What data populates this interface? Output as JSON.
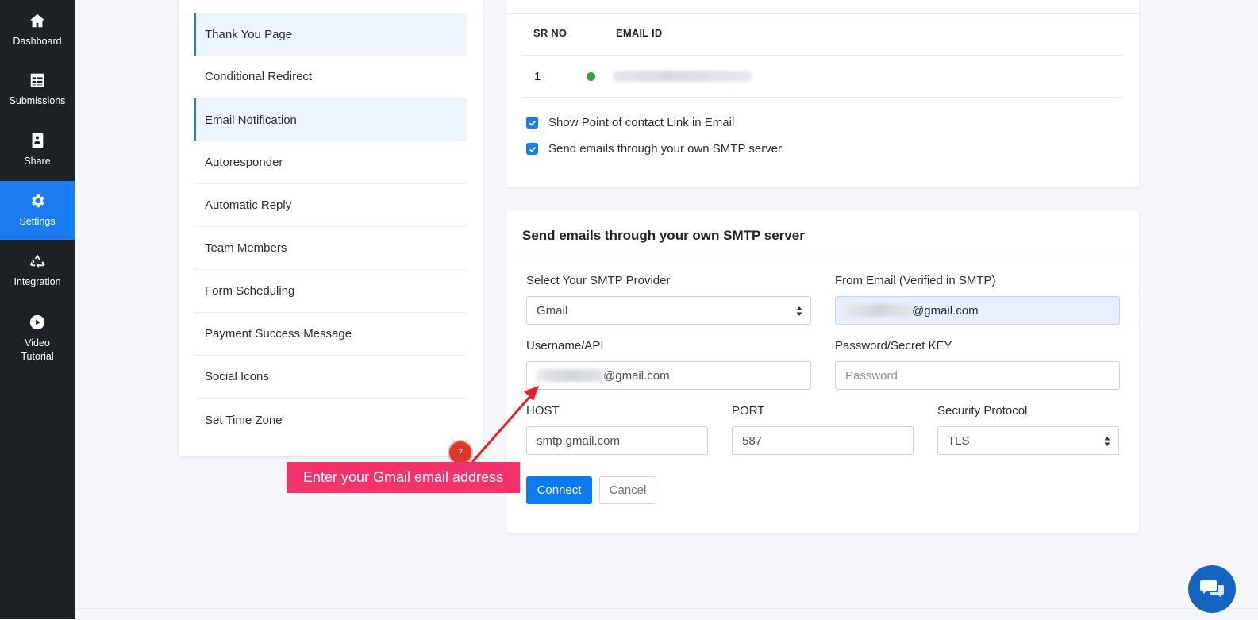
{
  "nav": {
    "items": [
      {
        "label": "Dashboard",
        "icon": "home-icon"
      },
      {
        "label": "Submissions",
        "icon": "table-icon"
      },
      {
        "label": "Share",
        "icon": "share-icon"
      },
      {
        "label": "Settings",
        "icon": "gear-icon"
      },
      {
        "label": "Integration",
        "icon": "recycle-icon"
      },
      {
        "label": "Video Tutorial",
        "icon": "play-icon"
      }
    ],
    "active": "Settings",
    "colors": {
      "background": "#1e2227",
      "active": "#1a7cf0"
    }
  },
  "settings_menu": {
    "items": [
      "Thank You Page",
      "Conditional Redirect",
      "Email Notification",
      "Autoresponder",
      "Automatic Reply",
      "Team Members",
      "Form Scheduling",
      "Payment Success Message",
      "Social Icons",
      "Set Time Zone"
    ],
    "highlighted": [
      "Thank You Page",
      "Email Notification"
    ]
  },
  "email_table": {
    "headers": [
      "SR NO",
      "EMAIL ID"
    ],
    "rows": [
      {
        "sr_no": "1",
        "status": "active",
        "status_color": "#28a745"
      }
    ]
  },
  "options": {
    "show_poc": {
      "label": "Show Point of contact Link in Email",
      "checked": true
    },
    "own_smtp": {
      "label": "Send emails through your own SMTP server.",
      "checked": true
    }
  },
  "smtp": {
    "title": "Send emails through your own SMTP server",
    "provider_label": "Select Your SMTP Provider",
    "provider_value": "Gmail",
    "from_email_label": "From Email (Verified in SMTP)",
    "from_email_suffix": "@gmail.com",
    "username_label": "Username/API",
    "username_suffix": "@gmail.com",
    "password_label": "Password/Secret KEY",
    "password_placeholder": "Password",
    "host_label": "HOST",
    "host_value": "smtp.gmail.com",
    "port_label": "PORT",
    "port_value": "587",
    "protocol_label": "Security Protocol",
    "protocol_value": "TLS",
    "connect_label": "Connect",
    "cancel_label": "Cancel"
  },
  "annotation": {
    "step": "7",
    "text": "Enter your Gmail email address",
    "color": "#f5326c"
  },
  "chat": {
    "icon": "chat-bubbles-icon",
    "color": "#1565c0"
  }
}
